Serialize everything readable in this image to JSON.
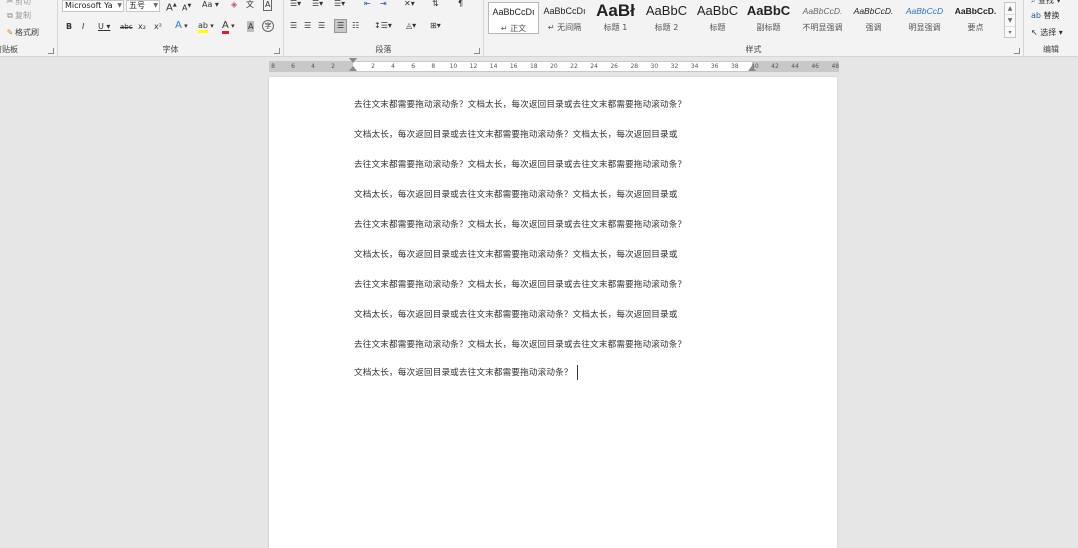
{
  "ribbon": {
    "clipboard": {
      "label": "剪贴板",
      "cut": "剪切",
      "copy": "复制",
      "format_painter": "格式刷"
    },
    "font": {
      "label": "字体",
      "font_name": "Microsoft Ya",
      "font_size": "五号",
      "grow": "A",
      "shrink": "A",
      "change_case": "Aa",
      "clear_format": "◈",
      "phonetic": "文",
      "border": "A",
      "bold": "B",
      "italic": "I",
      "underline": "U",
      "strike": "abc",
      "subscript": "x₂",
      "superscript": "x²",
      "text_effect": "A",
      "highlight": "ab",
      "font_color": "A",
      "char_shading": "A",
      "enclose": "字"
    },
    "paragraph": {
      "label": "段落"
    },
    "styles": {
      "label": "样式",
      "items": [
        {
          "sample": "AaBbCcDı",
          "name": "正文"
        },
        {
          "sample": "AaBbCcDı",
          "name": "无间隔"
        },
        {
          "sample": "AaBł",
          "name": "标题 1"
        },
        {
          "sample": "AaBbC",
          "name": "标题 2"
        },
        {
          "sample": "AaBbC",
          "name": "标题"
        },
        {
          "sample": "AaBbC",
          "name": "副标题"
        },
        {
          "sample": "AaBbCcD.",
          "name": "不明显强调"
        },
        {
          "sample": "AaBbCcD.",
          "name": "强调"
        },
        {
          "sample": "AaBbCcD",
          "name": "明显强调"
        },
        {
          "sample": "AaBbCcD.",
          "name": "要点"
        }
      ]
    },
    "editing": {
      "label": "编辑",
      "find": "查找",
      "replace": "替换",
      "select": "选择"
    }
  },
  "ruler": {
    "left_numbers": [
      "8",
      "6",
      "4",
      "2"
    ],
    "right_numbers": [
      "2",
      "4",
      "6",
      "8",
      "10",
      "12",
      "14",
      "16",
      "18",
      "20",
      "22",
      "24",
      "26",
      "28",
      "30",
      "32",
      "34",
      "36",
      "38",
      "40",
      "42",
      "44",
      "46",
      "48"
    ]
  },
  "document": {
    "lines": [
      "去往文末都需要拖动滚动条？文档太长，每次返回目录或去往文末都需要拖动滚动条？",
      "文档太长，每次返回目录或去往文末都需要拖动滚动条？文档太长，每次返回目录或",
      "去往文末都需要拖动滚动条？文档太长，每次返回目录或去往文末都需要拖动滚动条？",
      "文档太长，每次返回目录或去往文末都需要拖动滚动条？文档太长，每次返回目录或",
      "去往文末都需要拖动滚动条？文档太长，每次返回目录或去往文末都需要拖动滚动条？",
      "文档太长，每次返回目录或去往文末都需要拖动滚动条？文档太长，每次返回目录或",
      "去往文末都需要拖动滚动条？文档太长，每次返回目录或去往文末都需要拖动滚动条？",
      "文档太长，每次返回目录或去往文末都需要拖动滚动条？文档太长，每次返回目录或",
      "去往文末都需要拖动滚动条？文档太长，每次返回目录或去往文末都需要拖动滚动条？",
      "文档太长，每次返回目录或去往文末都需要拖动滚动条？"
    ]
  },
  "colors": {
    "accent": "#2b579a",
    "font_color_bar": "#e02020",
    "highlight_bar": "#ffff00"
  }
}
